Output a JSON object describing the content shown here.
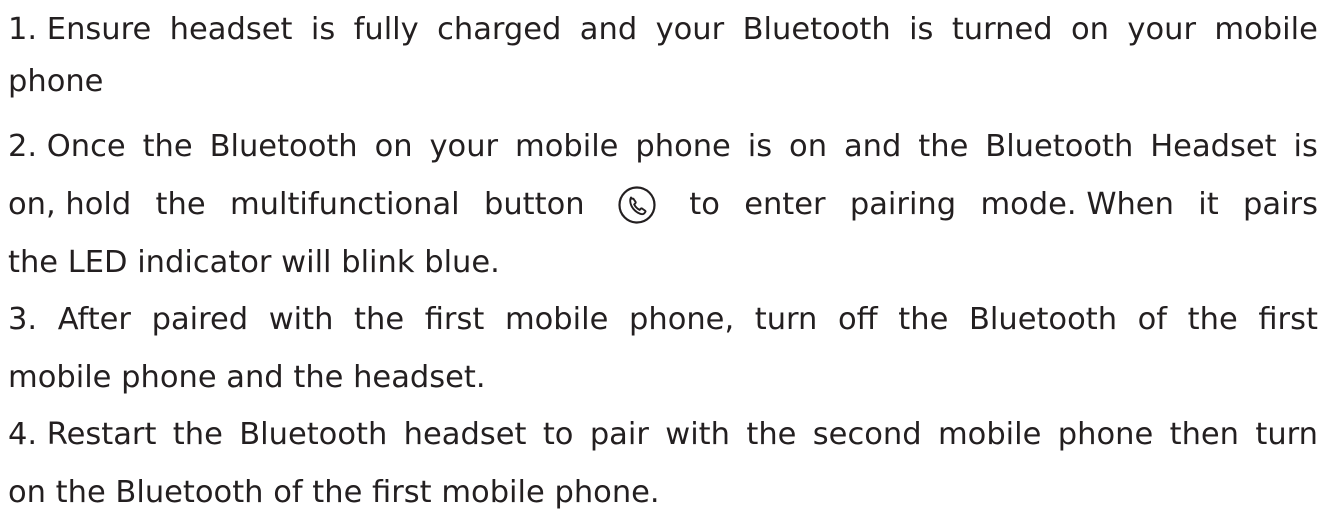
{
  "document": {
    "step1": {
      "line1_words": [
        "1. Ensure",
        "headset",
        "is",
        "fully",
        "charged",
        "and",
        "your",
        "Bluetooth",
        "is",
        "turned",
        "on",
        "your",
        "mobile"
      ],
      "line2": "phone"
    },
    "step2": {
      "line1_words": [
        "2. Once",
        "the",
        "Bluetooth",
        "on",
        "your",
        "mobile",
        "phone",
        "is",
        "on",
        "and",
        "the",
        "Bluetooth",
        "Headset",
        "is"
      ],
      "line2_before_icon": [
        "on, hold",
        "the",
        "multifunctional",
        "button"
      ],
      "line2_after_icon": [
        "to",
        "enter",
        "pairing",
        "mode. When",
        "it",
        "pairs"
      ],
      "line3": "the LED indicator will blink blue."
    },
    "step3": {
      "line1_words": [
        "3.",
        "After",
        "paired",
        "with",
        "the",
        "first",
        "mobile",
        "phone,",
        "turn",
        "off",
        "the",
        "Bluetooth",
        "of",
        "the",
        "first"
      ],
      "line2": "mobile phone and the headset."
    },
    "step4": {
      "line1_words": [
        "4. Restart",
        "the",
        "Bluetooth",
        "headset",
        "to",
        "pair",
        "with",
        "the",
        "second",
        "mobile",
        "phone",
        "then",
        "turn"
      ],
      "line2": "on the Bluetooth of the first mobile phone."
    },
    "icons": {
      "multifunction_button": "phone-handset-in-circle"
    },
    "colors": {
      "text": "#231f20",
      "background": "#ffffff"
    }
  }
}
